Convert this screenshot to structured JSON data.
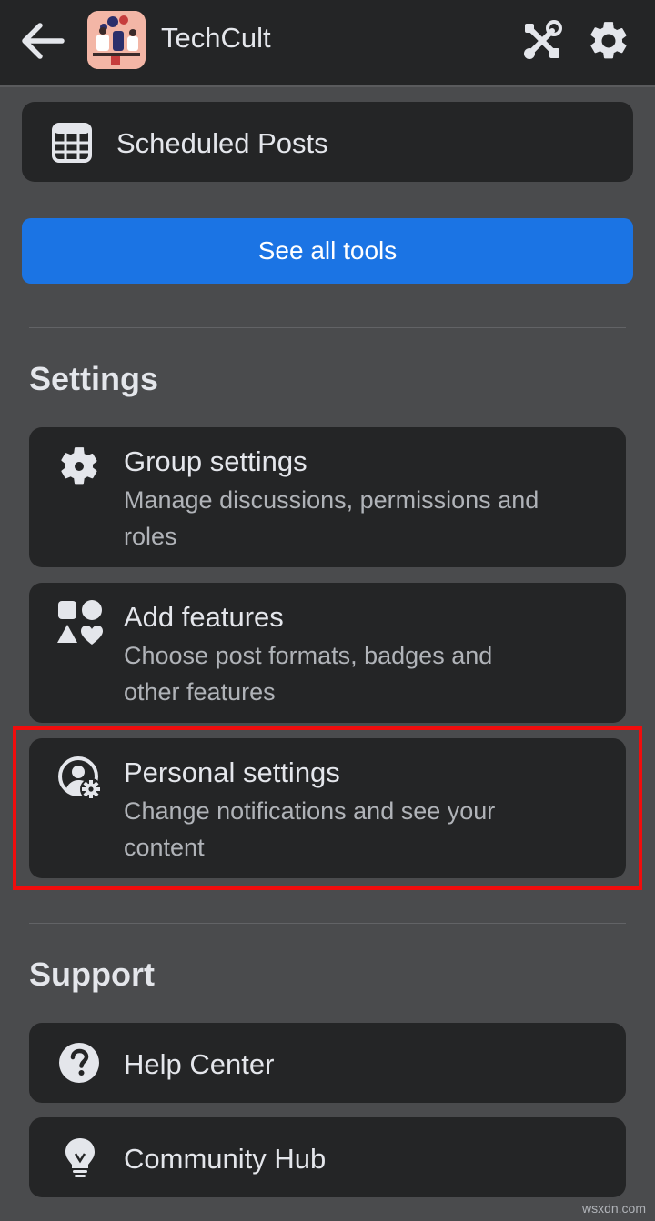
{
  "header": {
    "group_name": "TechCult",
    "back_icon": "arrow-left-icon",
    "tools_icon": "tools-icon",
    "settings_icon": "gear-icon"
  },
  "tools": {
    "scheduled_posts": "Scheduled Posts",
    "see_all_tools": "See all tools"
  },
  "settings": {
    "heading": "Settings",
    "items": [
      {
        "title": "Group settings",
        "subtitle_line1": "Manage discussions, permissions and",
        "subtitle_line2": "roles",
        "icon": "gear-icon"
      },
      {
        "title": "Add features",
        "subtitle_line1": "Choose post formats, badges and",
        "subtitle_line2": "other features",
        "icon": "shapes-icon"
      },
      {
        "title": "Personal settings",
        "subtitle_line1": "Change notifications and see your",
        "subtitle_line2": "content",
        "icon": "user-gear-icon"
      }
    ]
  },
  "support": {
    "heading": "Support",
    "items": [
      {
        "title": "Help Center",
        "icon": "question-circle-icon"
      },
      {
        "title": "Community Hub",
        "icon": "lightbulb-icon"
      }
    ]
  },
  "watermark": "wsxdn.com",
  "colors": {
    "background": "#4a4b4d",
    "card": "#242526",
    "primary_button": "#1b74e4",
    "highlight": "#f00d0d"
  }
}
